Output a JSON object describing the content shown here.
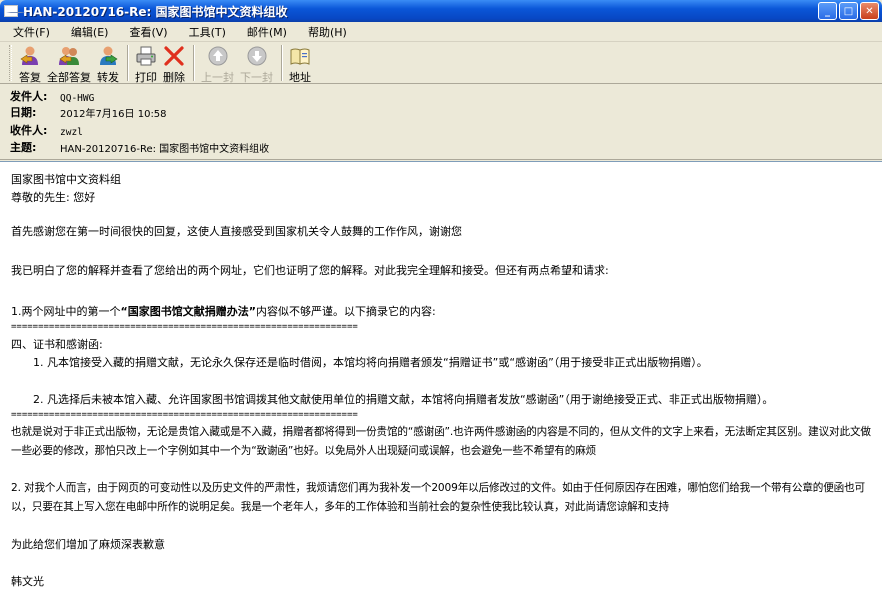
{
  "window": {
    "title": "HAN-20120716-Re: 国家图书馆中文资料组收",
    "controls": {
      "minimize": "_",
      "maximize": "□",
      "close": "✕"
    }
  },
  "menu": [
    "文件(F)",
    "编辑(E)",
    "查看(V)",
    "工具(T)",
    "邮件(M)",
    "帮助(H)"
  ],
  "toolbar": {
    "reply": "答复",
    "reply_all": "全部答复",
    "forward": "转发",
    "print": "打印",
    "delete": "删除",
    "prev": "上一封",
    "next": "下一封",
    "address": "地址"
  },
  "header": {
    "from_label": "发件人:",
    "from": "QQ-HWG",
    "date_label": "日期:",
    "date": "2012年7月16日 10:58",
    "to_label": "收件人:",
    "to": "zwzl",
    "subject_label": "主题:",
    "subject": "HAN-20120716-Re: 国家图书馆中文资料组收"
  },
  "body": {
    "l1": "国家图书馆中文资料组",
    "l2": "尊敬的先生:   您好",
    "l3": "首先感谢您在第一时间很快的回复，这使人直接感受到国家机关令人鼓舞的工作作风，谢谢您",
    "l4": "我已明白了您的解释并查看了您给出的两个网址，它们也证明了您的解释。对此我完全理解和接受。但还有两点希望和请求:",
    "l5a": "1.两个网址中的第一个",
    "l5b": "“国家图书馆文献捐赠办法”",
    "l5c": "内容似不够严谨。以下摘录它的内容:",
    "eq1": "================================================================",
    "l6": "四、证书和感谢函:",
    "l7": "1. 凡本馆接受入藏的捐赠文献，无论永久保存还是临时借阅，本馆均将向捐赠者颁发“捐赠证书”或“感谢函”（用于接受非正式出版物捐赠）。",
    "l8": "2. 凡选择后未被本馆入藏、允许国家图书馆调拨其他文献使用单位的捐赠文献，本馆将向捐赠者发放“感谢函”（用于谢绝接受正式、非正式出版物捐赠）。",
    "eq2": "================================================================",
    "l9": "也就是说对于非正式出版物，无论是贵馆入藏或是不入藏，捐赠者都将得到一份贵馆的“感谢函”.也许两件感谢函的内容是不同的，但从文件的文字上来看，无法断定其区别。建议对此文做一些必要的修改，那怕只改上一个字例如其中一个为“致谢函”也好。以免局外人出现疑问或误解，也会避免一些不希望有的麻烦",
    "l10": "2. 对我个人而言，由于网页的可变动性以及历史文件的严肃性，我烦请您们再为我补发一个2009年以后修改过的文件。如由于任何原因存在困难，哪怕您们给我一个带有公章的便函也可以，只要在其上写入您在电邮中所作的说明足矣。我是一个老年人，多年的工作体验和当前社会的复杂性使我比较认真，对此尚请您谅解和支持",
    "l11": "为此给您们增加了麻烦深表歉意",
    "l12": "韩文光"
  },
  "colors": {
    "titlebar": "#0a56d8",
    "chrome": "#ece9d8",
    "delete_x": "#e0301e"
  }
}
